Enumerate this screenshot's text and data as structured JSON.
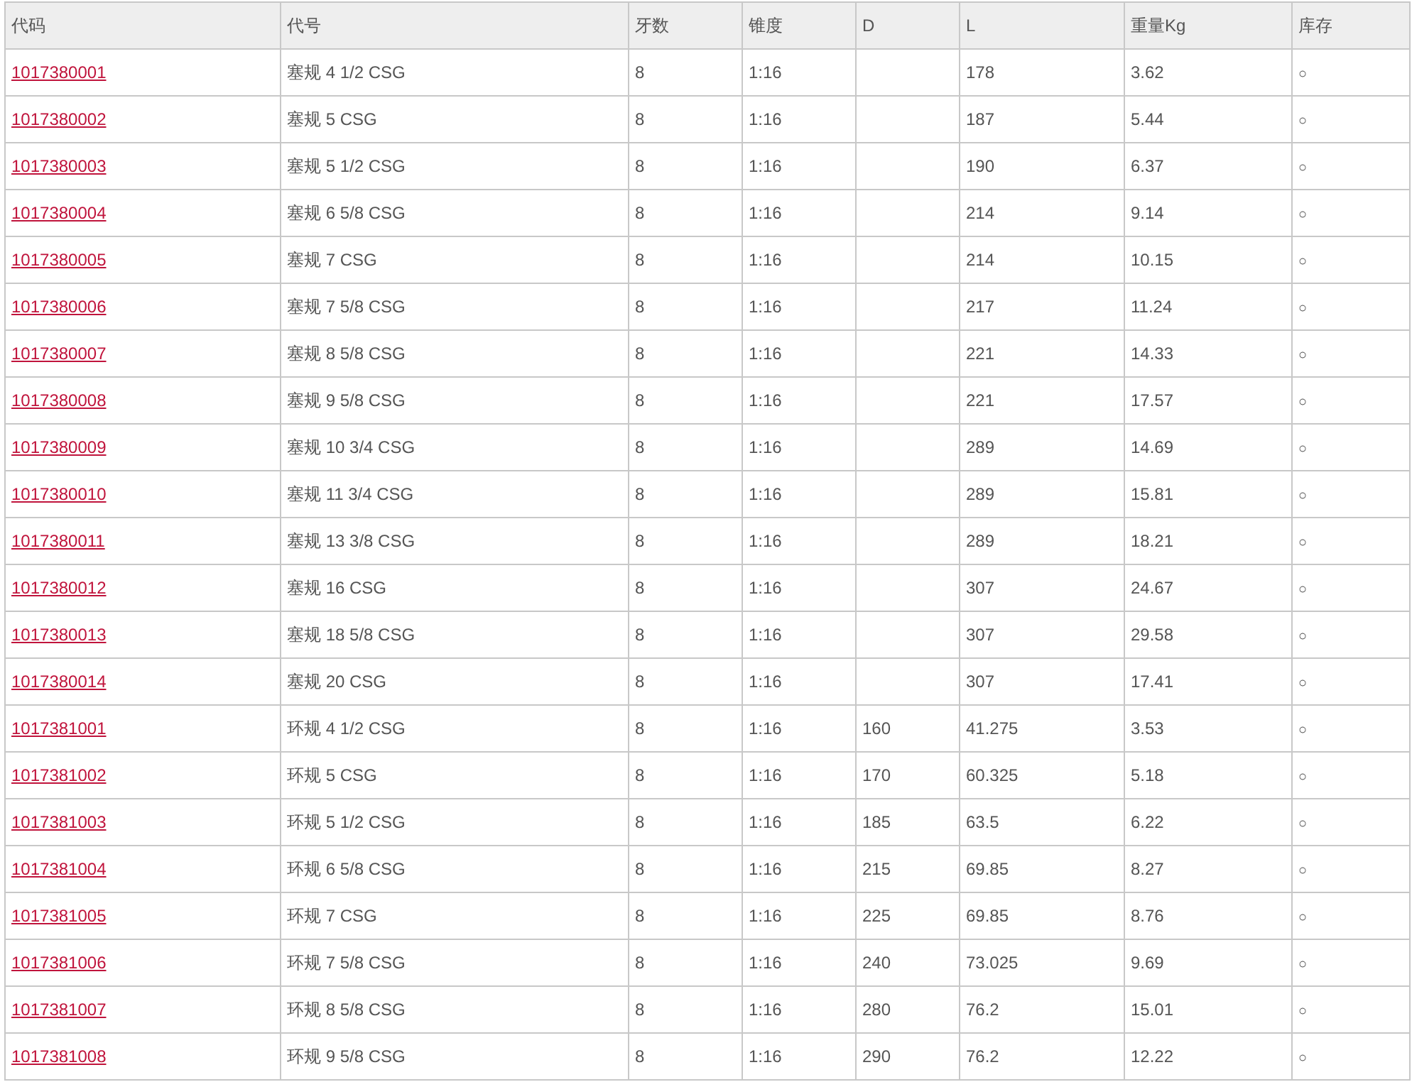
{
  "table": {
    "columns": [
      "代码",
      "代号",
      "牙数",
      "锥度",
      "D",
      "L",
      "重量Kg",
      "库存"
    ],
    "rows": [
      {
        "code": "1017380001",
        "name": "塞规 4 1/2 CSG",
        "teeth": "8",
        "taper": "1:16",
        "l": "178",
        "weight": "3.62",
        "stock": "○"
      },
      {
        "code": "1017380002",
        "name": "塞规 5 CSG",
        "teeth": "8",
        "taper": "1:16",
        "l": "187",
        "weight": "5.44",
        "stock": "○"
      },
      {
        "code": "1017380003",
        "name": "塞规 5 1/2 CSG",
        "teeth": "8",
        "taper": "1:16",
        "l": "190",
        "weight": "6.37",
        "stock": "○"
      },
      {
        "code": "1017380004",
        "name": "塞规 6 5/8 CSG",
        "teeth": "8",
        "taper": "1:16",
        "l": "214",
        "weight": "9.14",
        "stock": "○"
      },
      {
        "code": "1017380005",
        "name": "塞规 7 CSG",
        "teeth": "8",
        "taper": "1:16",
        "l": "214",
        "weight": "10.15",
        "stock": "○"
      },
      {
        "code": "1017380006",
        "name": "塞规 7 5/8 CSG",
        "teeth": "8",
        "taper": "1:16",
        "l": "217",
        "weight": "11.24",
        "stock": "○"
      },
      {
        "code": "1017380007",
        "name": "塞规 8 5/8 CSG",
        "teeth": "8",
        "taper": "1:16",
        "l": "221",
        "weight": "14.33",
        "stock": "○"
      },
      {
        "code": "1017380008",
        "name": "塞规 9 5/8 CSG",
        "teeth": "8",
        "taper": "1:16",
        "l": "221",
        "weight": "17.57",
        "stock": "○"
      },
      {
        "code": "1017380009",
        "name": "塞规 10 3/4 CSG",
        "teeth": "8",
        "taper": "1:16",
        "l": "289",
        "weight": "14.69",
        "stock": "○"
      },
      {
        "code": "1017380010",
        "name": "塞规 11 3/4 CSG",
        "teeth": "8",
        "taper": "1:16",
        "l": "289",
        "weight": "15.81",
        "stock": "○"
      },
      {
        "code": "1017380011",
        "name": "塞规 13 3/8 CSG",
        "teeth": "8",
        "taper": "1:16",
        "l": "289",
        "weight": "18.21",
        "stock": "○"
      },
      {
        "code": "1017380012",
        "name": "塞规 16 CSG",
        "teeth": "8",
        "taper": "1:16",
        "l": "307",
        "weight": "24.67",
        "stock": "○"
      },
      {
        "code": "1017380013",
        "name": "塞规 18 5/8 CSG",
        "teeth": "8",
        "taper": "1:16",
        "l": "307",
        "weight": "29.58",
        "stock": "○"
      },
      {
        "code": "1017380014",
        "name": "塞规 20 CSG",
        "teeth": "8",
        "taper": "1:16",
        "l": "307",
        "weight": "17.41",
        "stock": "○"
      },
      {
        "code": "1017381001",
        "name": "环规 4 1/2 CSG",
        "teeth": "8",
        "taper": "1:16",
        "d": "160",
        "l": "41.275",
        "weight": "3.53",
        "stock": "○"
      },
      {
        "code": "1017381002",
        "name": "环规 5 CSG",
        "teeth": "8",
        "taper": "1:16",
        "d": "170",
        "l": "60.325",
        "weight": "5.18",
        "stock": "○"
      },
      {
        "code": "1017381003",
        "name": "环规 5 1/2 CSG",
        "teeth": "8",
        "taper": "1:16",
        "d": "185",
        "l": "63.5",
        "weight": "6.22",
        "stock": "○"
      },
      {
        "code": "1017381004",
        "name": "环规 6 5/8 CSG",
        "teeth": "8",
        "taper": "1:16",
        "d": "215",
        "l": "69.85",
        "weight": "8.27",
        "stock": "○"
      },
      {
        "code": "1017381005",
        "name": "环规 7 CSG",
        "teeth": "8",
        "taper": "1:16",
        "d": "225",
        "l": "69.85",
        "weight": "8.76",
        "stock": "○"
      },
      {
        "code": "1017381006",
        "name": "环规 7 5/8 CSG",
        "teeth": "8",
        "taper": "1:16",
        "d": "240",
        "l": "73.025",
        "weight": "9.69",
        "stock": "○"
      },
      {
        "code": "1017381007",
        "name": "环规 8 5/8 CSG",
        "teeth": "8",
        "taper": "1:16",
        "d": "280",
        "l": "76.2",
        "weight": "15.01",
        "stock": "○"
      },
      {
        "code": "1017381008",
        "name": "环规 9 5/8 CSG",
        "teeth": "8",
        "taper": "1:16",
        "d": "290",
        "l": "76.2",
        "weight": "12.22",
        "stock": "○"
      }
    ]
  }
}
